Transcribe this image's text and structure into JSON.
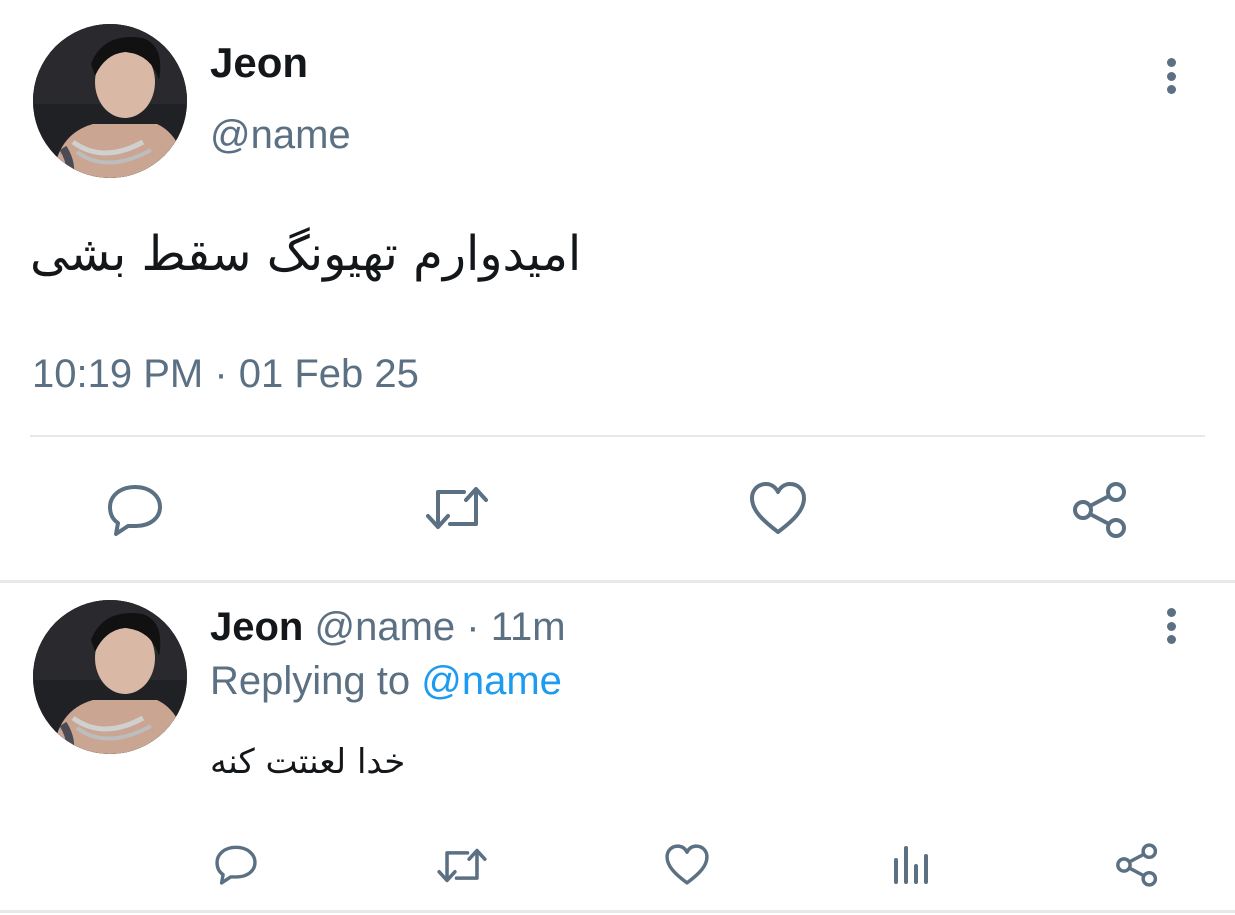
{
  "main_tweet": {
    "display_name": "Jeon",
    "handle": "@name",
    "text": "امیدوارم تهیونگ سقط بشی",
    "timestamp": "10:19 PM · 01 Feb 25",
    "actions": [
      "reply-icon",
      "retweet-icon",
      "like-icon",
      "share-icon"
    ]
  },
  "reply_tweet": {
    "display_name": "Jeon",
    "handle": "@name",
    "separator": "·",
    "time_ago": "11m",
    "replying_to_label": "Replying to",
    "replying_to_handle": "@name",
    "text": "خدا لعنتت کنه",
    "actions": [
      "reply-icon",
      "retweet-icon",
      "like-icon",
      "analytics-icon",
      "share-icon"
    ]
  },
  "colors": {
    "text": "#14171a",
    "muted": "#5b7083",
    "link": "#1d9bf0",
    "divider": "#e6e9ec"
  }
}
